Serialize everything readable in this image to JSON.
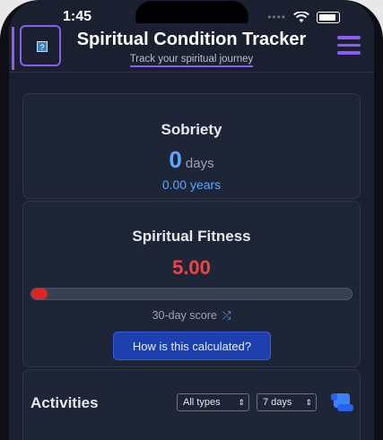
{
  "status": {
    "time": "1:45"
  },
  "header": {
    "title": "Spiritual Condition Tracker",
    "subtitle": "Track your spiritual journey",
    "help_icon": "?"
  },
  "sobriety": {
    "title": "Sobriety",
    "days_value": "0",
    "days_unit": "days",
    "years": "0.00 years"
  },
  "fitness": {
    "title": "Spiritual Fitness",
    "score": "5.00",
    "score_progress_percent": 5,
    "period_label": "30-day score",
    "calc_button": "How is this calculated?"
  },
  "activities": {
    "title": "Activities",
    "type_filter": "All types",
    "range_filter": "7 days"
  },
  "colors": {
    "accent": "#8b5cf6",
    "score": "#ef4444",
    "blue": "#60a5fa",
    "button": "#1e40af"
  },
  "icons": [
    "help-icon",
    "menu-icon",
    "wifi-icon",
    "battery-icon",
    "shuffle-icon",
    "chevron-updown-icon",
    "scroll-icon"
  ]
}
